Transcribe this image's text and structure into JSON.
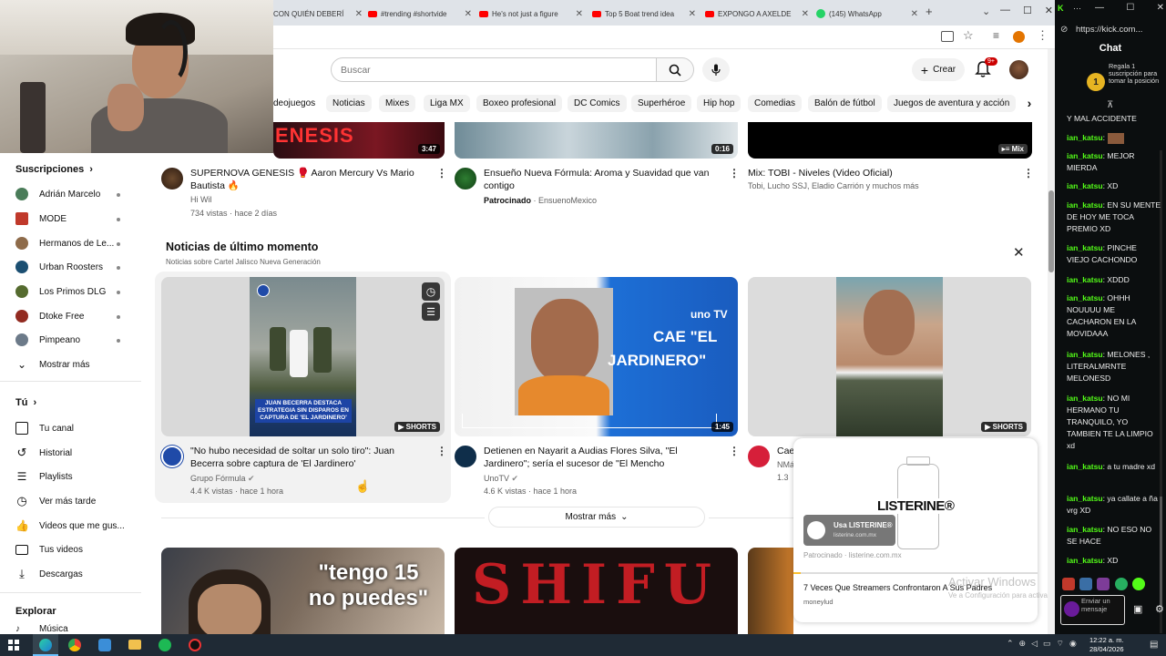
{
  "browser": {
    "tabs": [
      {
        "title": "CON QUIÉN DEBERÍ",
        "icon": "none"
      },
      {
        "title": "#trending #shortvide",
        "icon": "youtube"
      },
      {
        "title": "He's not just a figure",
        "icon": "youtube"
      },
      {
        "title": "Top 5 Boat trend idea",
        "icon": "youtube"
      },
      {
        "title": "EXPONGO A AXELDE",
        "icon": "youtube"
      },
      {
        "title": "(145) WhatsApp",
        "icon": "whatsapp"
      }
    ],
    "new_tab": "+"
  },
  "youtube": {
    "search_placeholder": "Buscar",
    "create_label": "Crear",
    "notif_badge": "9+",
    "chips": [
      "deojuegos",
      "Noticias",
      "Mixes",
      "Liga MX",
      "Boxeo profesional",
      "DC Comics",
      "Superhéroe",
      "Hip hop",
      "Comedias",
      "Balón de fútbol",
      "Juegos de aventura y acción"
    ],
    "sidebar": {
      "subs_heading": "Suscripciones",
      "subs": [
        {
          "name": "Adrián Marcelo",
          "color": "#4a7c59"
        },
        {
          "name": "MODE",
          "color": "#c0392b"
        },
        {
          "name": "Hermanos de Le...",
          "color": "#8e6b4a"
        },
        {
          "name": "Urban Roosters",
          "color": "#1b4f72"
        },
        {
          "name": "Los Primos DLG",
          "color": "#556b2f"
        },
        {
          "name": "Dtoke Free",
          "color": "#922b21"
        },
        {
          "name": "Pimpeano",
          "color": "#6c7a89"
        }
      ],
      "show_more": "Mostrar más",
      "you_heading": "Tú",
      "you_items": [
        "Tu canal",
        "Historial",
        "Playlists",
        "Ver más tarde",
        "Videos que me gus...",
        "Tus videos",
        "Descargas"
      ],
      "explore_heading": "Explorar",
      "explore_cut": "Música"
    },
    "top_row": [
      {
        "title_line1": "SUPERNOVA GENESIS 🥊 Aaron Mercury Vs Mario",
        "title_line2": "Bautista 🔥",
        "channel": "Hi Wil",
        "meta": "734 vistas · hace 2 días",
        "duration": "3:47",
        "thumb_text": "ENESIS"
      },
      {
        "title_line1": "Ensueño Nueva Fórmula: Aroma y Suavidad que van",
        "title_line2": "contigo",
        "sponsored": "Patrocinado",
        "channel": "EnsuenoMexico",
        "duration": "0:16"
      },
      {
        "title_line1": "Mix: TOBI - Niveles (Video Oficial)",
        "channel": "Tobi, Lucho SSJ, Eladio Carrión y muchos más",
        "duration": "Mix"
      }
    ],
    "news": {
      "heading": "Noticias de último momento",
      "subheading": "Noticias sobre Cartel Jalisco Nueva Generación",
      "items": [
        {
          "title_line1": "\"No hubo necesidad de soltar un solo tiro\": Juan",
          "title_line2": "Becerra sobre captura de 'El Jardinero'",
          "channel": "Grupo Fórmula",
          "meta": "4.4 K vistas · hace 1 hora",
          "badge": "SHORTS",
          "caption": "JUAN BECERRA DESTACA ESTRATEGIA SIN DISPAROS EN CAPTURA DE 'EL JARDINERO'"
        },
        {
          "title_line1": "Detienen en Nayarit a Audias Flores Silva, \"El",
          "title_line2": "Jardinero\"; sería el sucesor de \"El Mencho",
          "channel": "UnoTV",
          "meta": "4.6 K vistas · hace 1 hora",
          "duration": "1:45",
          "caption1": "CAE \"EL",
          "caption2": "JARDINERO\"",
          "logo": "uno TV"
        },
        {
          "title_line1": "Cae",
          "channel": "NMá",
          "meta": "1.3",
          "badge": "SHORTS"
        }
      ],
      "show_more": "Mostrar más"
    },
    "bottom_row": [
      {
        "caption": "\"tengo 15\nno puedes\""
      },
      {
        "caption": "SHIFU"
      }
    ],
    "ad": {
      "brand": "LISTERINE®",
      "cta_title": "Usa LISTERINE®",
      "cta_url": "listerine.com.mx",
      "sponsored": "Patrocinado · listerine.com.mx",
      "video_title": "7 Veces Que Streamers Confrontaron A Sus Padres",
      "video_channel": "moneylud"
    },
    "watermark1": "Activar Windows",
    "watermark2": "Ve a Configuración para activar"
  },
  "kick": {
    "url": "https://kick.com...",
    "title": "Chat",
    "gift_text": "Regala 1 suscripción para tomar la posición",
    "gift_rank": "1",
    "messages": [
      {
        "user": "",
        "text": "Y MAL ACCIDENTE",
        "y": 0
      },
      {
        "user": "ian_katsu",
        "text": ":",
        "emote": true
      },
      {
        "user": "ian_katsu",
        "text": ": MEJOR MIERDA"
      },
      {
        "user": "ian_katsu",
        "text": ": XD"
      },
      {
        "user": "ian_katsu",
        "text": ": EN SU MENTE DE HOY ME TOCA PREMIO XD"
      },
      {
        "user": "ian_katsu",
        "text": ": PINCHE VIEJO CACHONDO"
      },
      {
        "user": "ian_katsu",
        "text": ": XDDD"
      },
      {
        "user": "ian_katsu",
        "text": ": OHHH NOUUUU ME CACHARON EN LA MOVIDAAA"
      },
      {
        "user": "ian_katsu",
        "text": ": MELONES , LITERALMRNTE MELONESD"
      },
      {
        "user": "ian_katsu",
        "text": ": NO MI HERMANO TU TRANQUILO, YO TAMBIEN TE LA LIMPIO xd"
      },
      {
        "user": "ian_katsu",
        "text": ": a tu madre xd"
      },
      {
        "user": "ian_katsu",
        "text": ": ya callate a ña vrg XD"
      },
      {
        "user": "ian_katsu",
        "text": ": NO ESO NO SE HACE"
      },
      {
        "user": "ian_katsu",
        "text": ": XD"
      }
    ],
    "send_placeholder": "Enviar un mensaje"
  },
  "taskbar": {
    "time": "12:22 a. m.",
    "date": "28/04/2026"
  }
}
